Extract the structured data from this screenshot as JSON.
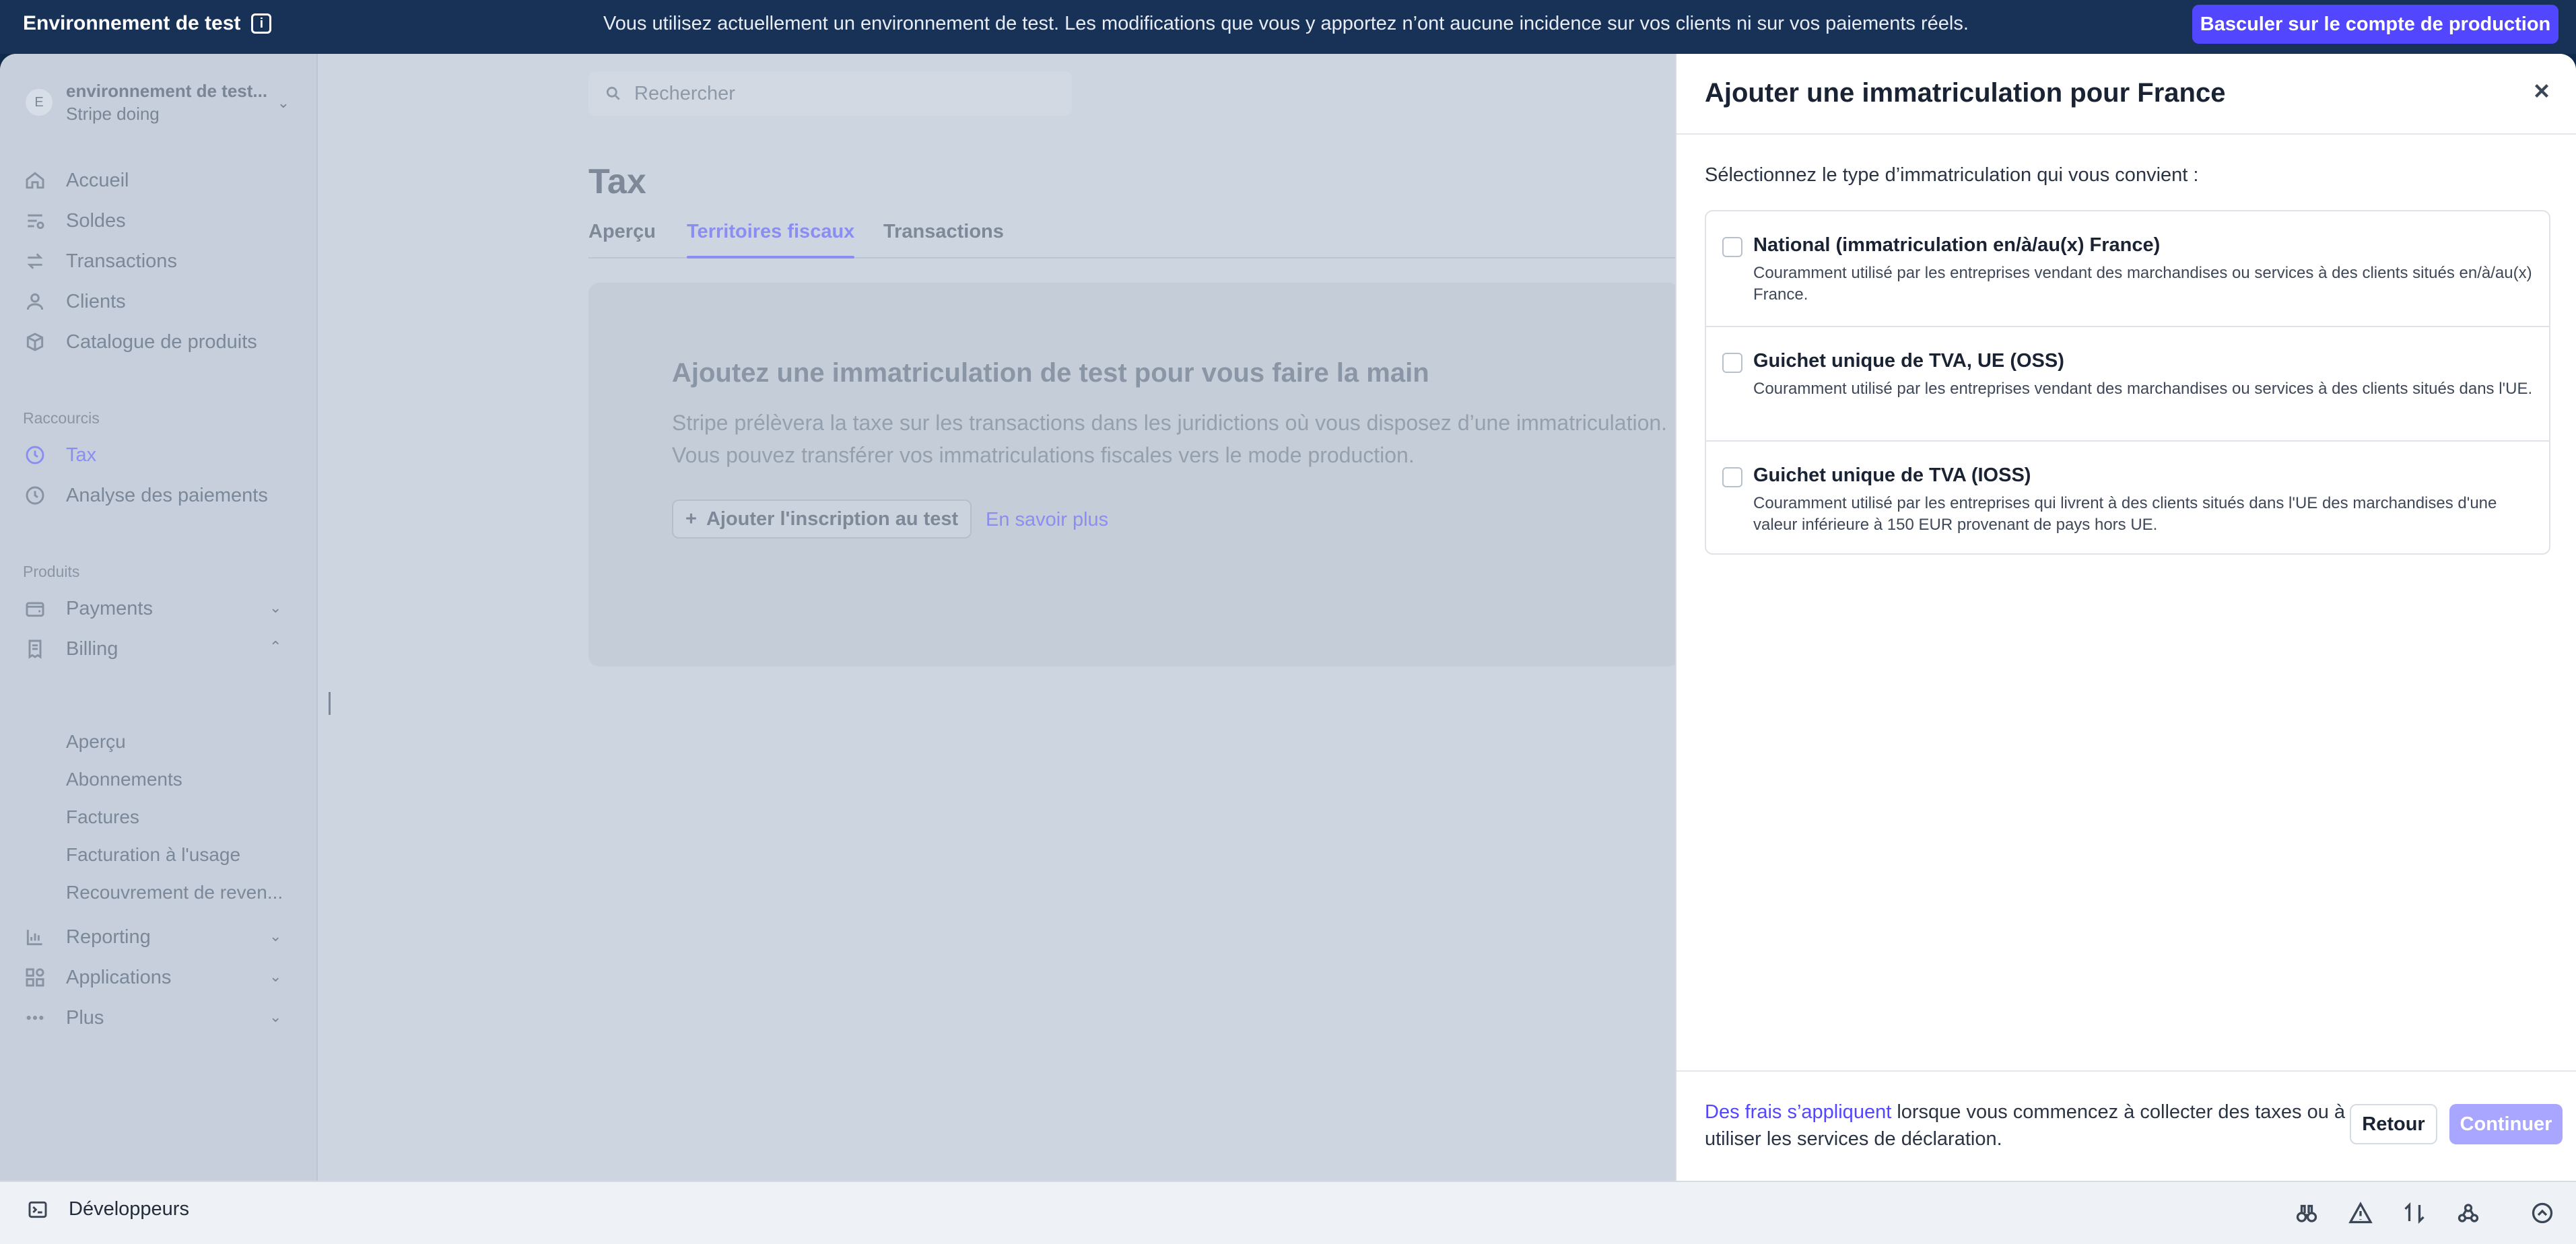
{
  "banner": {
    "env_label": "Environnement de test",
    "info_glyph": "i",
    "message": "Vous utilisez actuellement un environnement de test. Les modifications que vous y apportez n’ont aucune incidence sur vos clients ni sur vos paiements réels.",
    "prod_button": "Basculer sur le compte de production"
  },
  "account": {
    "initial": "E",
    "name": "environnement de test...",
    "subtitle": "Stripe doing"
  },
  "sidebar": {
    "nav": [
      {
        "label": "Accueil",
        "icon": "home-icon"
      },
      {
        "label": "Soldes",
        "icon": "balance-icon"
      },
      {
        "label": "Transactions",
        "icon": "transactions-icon"
      },
      {
        "label": "Clients",
        "icon": "person-icon"
      },
      {
        "label": "Catalogue de produits",
        "icon": "box-icon"
      }
    ],
    "shortcuts_label": "Raccourcis",
    "shortcuts": [
      {
        "label": "Tax",
        "icon": "clock-icon",
        "active": true
      },
      {
        "label": "Analyse des paiements",
        "icon": "clock-icon"
      }
    ],
    "products_label": "Produits",
    "products": [
      {
        "label": "Payments",
        "icon": "wallet-icon"
      },
      {
        "label": "Billing",
        "icon": "invoice-icon"
      }
    ],
    "billing_sub": [
      "Aperçu",
      "Abonnements",
      "Factures",
      "Facturation à l'usage",
      "Recouvrement de reven..."
    ],
    "more": [
      {
        "label": "Reporting",
        "icon": "chart-icon"
      },
      {
        "label": "Applications",
        "icon": "apps-icon"
      },
      {
        "label": "Plus",
        "icon": "more-icon"
      }
    ]
  },
  "developers": {
    "label": "Développeurs"
  },
  "main": {
    "search_placeholder": "Rechercher",
    "title": "Tax",
    "tabs": [
      "Aperçu",
      "Territoires fiscaux",
      "Transactions"
    ],
    "card": {
      "heading": "Ajoutez une immatriculation de test pour vous faire la main",
      "body": "Stripe prélèvera la taxe sur les transactions dans les juridictions où vous disposez d’une immatriculation. Vous pouvez transférer vos immatriculations fiscales vers le mode production.",
      "add_button": "Ajouter l'inscription au test",
      "learn_more": "En savoir plus"
    }
  },
  "drawer": {
    "title": "Ajouter une immatriculation pour France",
    "prompt": "Sélectionnez le type d’immatriculation qui vous convient :",
    "options": [
      {
        "title": "National (immatriculation en/à/au(x) France)",
        "desc": "Couramment utilisé par les entreprises vendant des marchandises ou services à des clients situés en/à/au(x) France."
      },
      {
        "title": "Guichet unique de TVA, UE (OSS)",
        "desc": "Couramment utilisé par les entreprises vendant des marchandises ou services à des clients situés dans l'UE."
      },
      {
        "title": "Guichet unique de TVA (IOSS)",
        "desc": "Couramment utilisé par les entreprises qui livrent à des clients situés dans l'UE des marchandises d'une valeur inférieure à 150 EUR provenant de pays hors UE."
      }
    ],
    "footer": {
      "link": "Des frais s’appliquent",
      "note": " lorsque vous commencez à collecter des taxes ou à utiliser les services de déclaration.",
      "back": "Retour",
      "continue": "Continuer"
    }
  }
}
